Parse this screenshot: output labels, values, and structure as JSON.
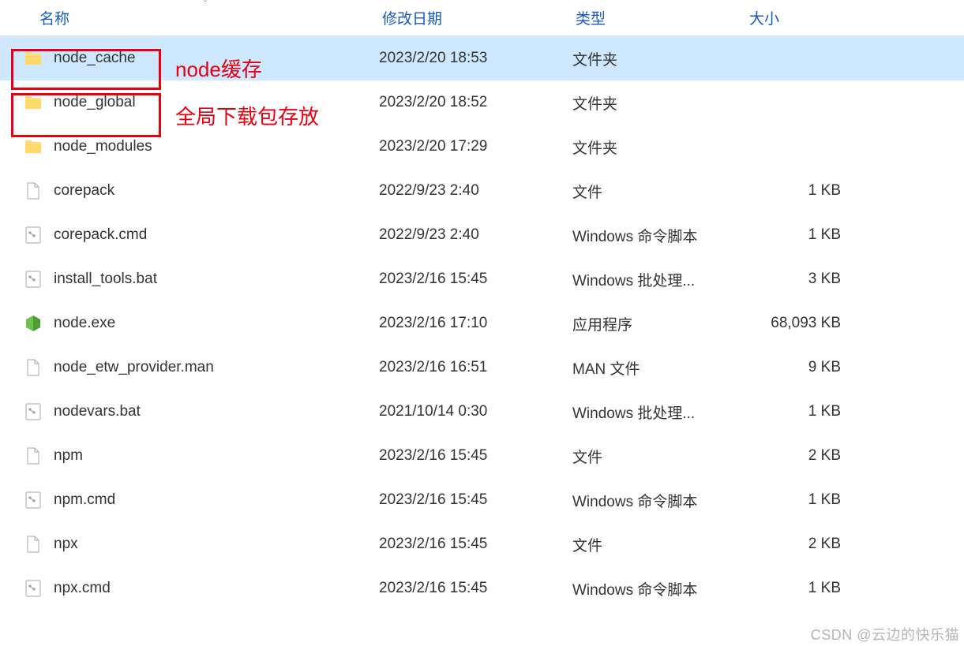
{
  "columns": {
    "name": "名称",
    "date": "修改日期",
    "type": "类型",
    "size": "大小"
  },
  "annotations": {
    "node_cache": "node缓存",
    "node_global": "全局下载包存放"
  },
  "items": [
    {
      "icon": "folder",
      "name": "node_cache",
      "date": "2023/2/20 18:53",
      "type": "文件夹",
      "size": "",
      "selected": true
    },
    {
      "icon": "folder",
      "name": "node_global",
      "date": "2023/2/20 18:52",
      "type": "文件夹",
      "size": ""
    },
    {
      "icon": "folder",
      "name": "node_modules",
      "date": "2023/2/20 17:29",
      "type": "文件夹",
      "size": ""
    },
    {
      "icon": "file",
      "name": "corepack",
      "date": "2022/9/23 2:40",
      "type": "文件",
      "size": "1 KB"
    },
    {
      "icon": "script",
      "name": "corepack.cmd",
      "date": "2022/9/23 2:40",
      "type": "Windows 命令脚本",
      "size": "1 KB"
    },
    {
      "icon": "script",
      "name": "install_tools.bat",
      "date": "2023/2/16 15:45",
      "type": "Windows 批处理...",
      "size": "3 KB"
    },
    {
      "icon": "node",
      "name": "node.exe",
      "date": "2023/2/16 17:10",
      "type": "应用程序",
      "size": "68,093 KB"
    },
    {
      "icon": "file",
      "name": "node_etw_provider.man",
      "date": "2023/2/16 16:51",
      "type": "MAN 文件",
      "size": "9 KB"
    },
    {
      "icon": "script",
      "name": "nodevars.bat",
      "date": "2021/10/14 0:30",
      "type": "Windows 批处理...",
      "size": "1 KB"
    },
    {
      "icon": "file",
      "name": "npm",
      "date": "2023/2/16 15:45",
      "type": "文件",
      "size": "2 KB"
    },
    {
      "icon": "script",
      "name": "npm.cmd",
      "date": "2023/2/16 15:45",
      "type": "Windows 命令脚本",
      "size": "1 KB"
    },
    {
      "icon": "file",
      "name": "npx",
      "date": "2023/2/16 15:45",
      "type": "文件",
      "size": "2 KB"
    },
    {
      "icon": "script",
      "name": "npx.cmd",
      "date": "2023/2/16 15:45",
      "type": "Windows 命令脚本",
      "size": "1 KB"
    }
  ],
  "watermark": "CSDN @云边的快乐猫"
}
